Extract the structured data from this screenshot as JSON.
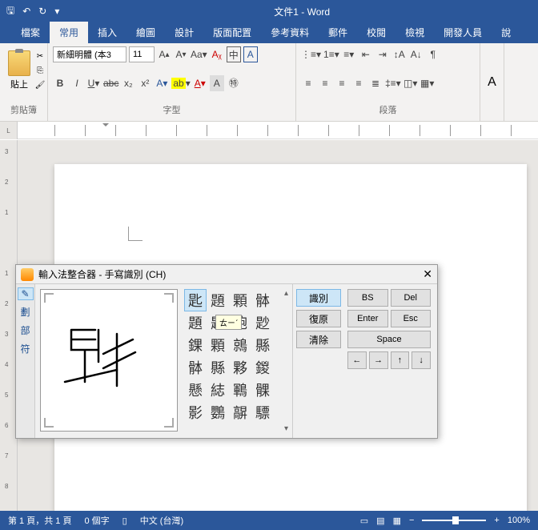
{
  "titlebar": {
    "title": "文件1 - Word"
  },
  "tabs": [
    "檔案",
    "常用",
    "插入",
    "繪圖",
    "設計",
    "版面配置",
    "參考資料",
    "郵件",
    "校閱",
    "檢視",
    "開發人員",
    "說"
  ],
  "active_tab": 1,
  "ribbon": {
    "clipboard": {
      "paste": "貼上",
      "label": "剪貼簿"
    },
    "font": {
      "name": "新細明體 (本3",
      "size": "11",
      "label": "字型"
    },
    "paragraph": {
      "label": "段落"
    }
  },
  "ime": {
    "title": "輸入法整合器 - 手寫識別 (CH)",
    "side": [
      "劃",
      "部",
      "符"
    ],
    "candidates": [
      "匙",
      "題",
      "顆",
      "骵",
      "題",
      "尟",
      "匏",
      "尟",
      "錁",
      "顆",
      "鶁",
      "縣",
      "骵",
      "縣",
      "夥",
      "鍐",
      "懸",
      "綕",
      "鶤",
      "髁",
      "影",
      "鸚",
      "髜",
      "驃"
    ],
    "tooltip": "ㄊㄧˊ",
    "actions": {
      "recognize": "識別",
      "undo": "復原",
      "clear": "清除"
    },
    "keys": {
      "bs": "BS",
      "del": "Del",
      "enter": "Enter",
      "esc": "Esc",
      "space": "Space"
    }
  },
  "status": {
    "page": "第 1 頁，共 1 頁",
    "words": "0 個字",
    "lang": "中文 (台灣)",
    "zoom": "100%"
  }
}
